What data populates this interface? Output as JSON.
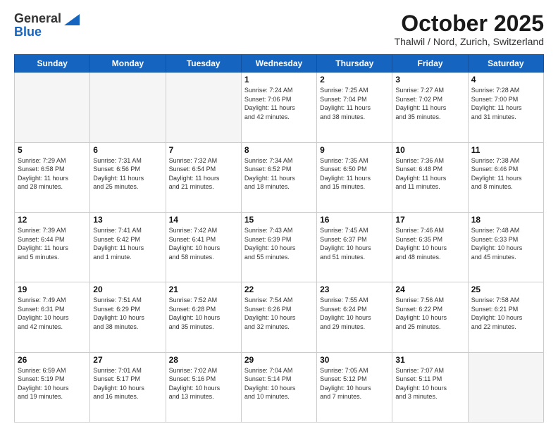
{
  "header": {
    "logo_general": "General",
    "logo_blue": "Blue",
    "month_title": "October 2025",
    "subtitle": "Thalwil / Nord, Zurich, Switzerland"
  },
  "days_of_week": [
    "Sunday",
    "Monday",
    "Tuesday",
    "Wednesday",
    "Thursday",
    "Friday",
    "Saturday"
  ],
  "weeks": [
    [
      {
        "day": "",
        "text": ""
      },
      {
        "day": "",
        "text": ""
      },
      {
        "day": "",
        "text": ""
      },
      {
        "day": "1",
        "text": "Sunrise: 7:24 AM\nSunset: 7:06 PM\nDaylight: 11 hours\nand 42 minutes."
      },
      {
        "day": "2",
        "text": "Sunrise: 7:25 AM\nSunset: 7:04 PM\nDaylight: 11 hours\nand 38 minutes."
      },
      {
        "day": "3",
        "text": "Sunrise: 7:27 AM\nSunset: 7:02 PM\nDaylight: 11 hours\nand 35 minutes."
      },
      {
        "day": "4",
        "text": "Sunrise: 7:28 AM\nSunset: 7:00 PM\nDaylight: 11 hours\nand 31 minutes."
      }
    ],
    [
      {
        "day": "5",
        "text": "Sunrise: 7:29 AM\nSunset: 6:58 PM\nDaylight: 11 hours\nand 28 minutes."
      },
      {
        "day": "6",
        "text": "Sunrise: 7:31 AM\nSunset: 6:56 PM\nDaylight: 11 hours\nand 25 minutes."
      },
      {
        "day": "7",
        "text": "Sunrise: 7:32 AM\nSunset: 6:54 PM\nDaylight: 11 hours\nand 21 minutes."
      },
      {
        "day": "8",
        "text": "Sunrise: 7:34 AM\nSunset: 6:52 PM\nDaylight: 11 hours\nand 18 minutes."
      },
      {
        "day": "9",
        "text": "Sunrise: 7:35 AM\nSunset: 6:50 PM\nDaylight: 11 hours\nand 15 minutes."
      },
      {
        "day": "10",
        "text": "Sunrise: 7:36 AM\nSunset: 6:48 PM\nDaylight: 11 hours\nand 11 minutes."
      },
      {
        "day": "11",
        "text": "Sunrise: 7:38 AM\nSunset: 6:46 PM\nDaylight: 11 hours\nand 8 minutes."
      }
    ],
    [
      {
        "day": "12",
        "text": "Sunrise: 7:39 AM\nSunset: 6:44 PM\nDaylight: 11 hours\nand 5 minutes."
      },
      {
        "day": "13",
        "text": "Sunrise: 7:41 AM\nSunset: 6:42 PM\nDaylight: 11 hours\nand 1 minute."
      },
      {
        "day": "14",
        "text": "Sunrise: 7:42 AM\nSunset: 6:41 PM\nDaylight: 10 hours\nand 58 minutes."
      },
      {
        "day": "15",
        "text": "Sunrise: 7:43 AM\nSunset: 6:39 PM\nDaylight: 10 hours\nand 55 minutes."
      },
      {
        "day": "16",
        "text": "Sunrise: 7:45 AM\nSunset: 6:37 PM\nDaylight: 10 hours\nand 51 minutes."
      },
      {
        "day": "17",
        "text": "Sunrise: 7:46 AM\nSunset: 6:35 PM\nDaylight: 10 hours\nand 48 minutes."
      },
      {
        "day": "18",
        "text": "Sunrise: 7:48 AM\nSunset: 6:33 PM\nDaylight: 10 hours\nand 45 minutes."
      }
    ],
    [
      {
        "day": "19",
        "text": "Sunrise: 7:49 AM\nSunset: 6:31 PM\nDaylight: 10 hours\nand 42 minutes."
      },
      {
        "day": "20",
        "text": "Sunrise: 7:51 AM\nSunset: 6:29 PM\nDaylight: 10 hours\nand 38 minutes."
      },
      {
        "day": "21",
        "text": "Sunrise: 7:52 AM\nSunset: 6:28 PM\nDaylight: 10 hours\nand 35 minutes."
      },
      {
        "day": "22",
        "text": "Sunrise: 7:54 AM\nSunset: 6:26 PM\nDaylight: 10 hours\nand 32 minutes."
      },
      {
        "day": "23",
        "text": "Sunrise: 7:55 AM\nSunset: 6:24 PM\nDaylight: 10 hours\nand 29 minutes."
      },
      {
        "day": "24",
        "text": "Sunrise: 7:56 AM\nSunset: 6:22 PM\nDaylight: 10 hours\nand 25 minutes."
      },
      {
        "day": "25",
        "text": "Sunrise: 7:58 AM\nSunset: 6:21 PM\nDaylight: 10 hours\nand 22 minutes."
      }
    ],
    [
      {
        "day": "26",
        "text": "Sunrise: 6:59 AM\nSunset: 5:19 PM\nDaylight: 10 hours\nand 19 minutes."
      },
      {
        "day": "27",
        "text": "Sunrise: 7:01 AM\nSunset: 5:17 PM\nDaylight: 10 hours\nand 16 minutes."
      },
      {
        "day": "28",
        "text": "Sunrise: 7:02 AM\nSunset: 5:16 PM\nDaylight: 10 hours\nand 13 minutes."
      },
      {
        "day": "29",
        "text": "Sunrise: 7:04 AM\nSunset: 5:14 PM\nDaylight: 10 hours\nand 10 minutes."
      },
      {
        "day": "30",
        "text": "Sunrise: 7:05 AM\nSunset: 5:12 PM\nDaylight: 10 hours\nand 7 minutes."
      },
      {
        "day": "31",
        "text": "Sunrise: 7:07 AM\nSunset: 5:11 PM\nDaylight: 10 hours\nand 3 minutes."
      },
      {
        "day": "",
        "text": ""
      }
    ]
  ]
}
